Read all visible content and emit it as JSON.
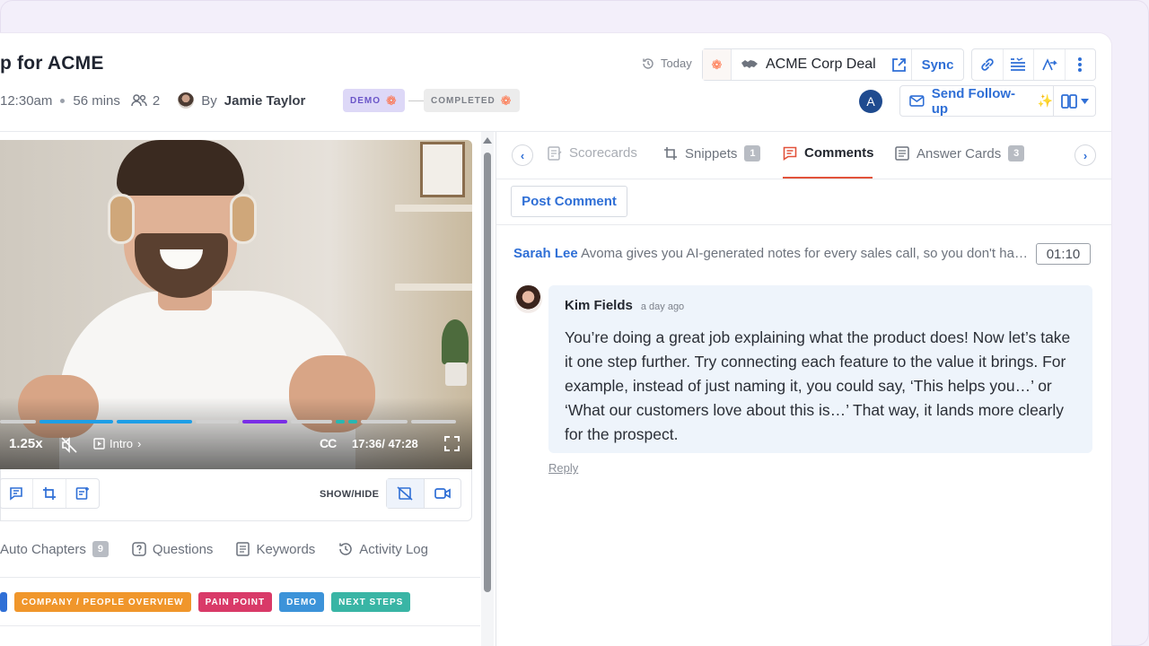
{
  "header": {
    "title": "p for ACME",
    "time": "12:30am",
    "duration": "56 mins",
    "participants": "2",
    "by_prefix": "By",
    "owner": "Jamie Taylor",
    "pills": [
      {
        "label": "DEMO"
      },
      {
        "label": "COMPLETED"
      }
    ],
    "today": "Today",
    "deal_name": "ACME Corp Deal",
    "sync": "Sync",
    "user_initial": "A",
    "follow_up": "Send Follow-up"
  },
  "video": {
    "speed": "1.25x",
    "chapter": "Intro",
    "cc": "CC",
    "time": "17:36/ 47:28",
    "progress_segments": [
      {
        "color": "#d0d0d0",
        "w": 40
      },
      {
        "color": "#1e9fe6",
        "w": 82
      },
      {
        "color": "#1e9fe6",
        "w": 84
      },
      {
        "color": "#d0d0d0",
        "w": 48
      },
      {
        "color": "#7a2ee6",
        "w": 50
      },
      {
        "color": "#d0d0d0",
        "w": 46
      },
      {
        "color": "#28b7b2",
        "w": 10
      },
      {
        "color": "#28b7b2",
        "w": 10
      },
      {
        "color": "#d0d0d0",
        "w": 52
      },
      {
        "color": "#d0d0d0",
        "w": 50
      }
    ]
  },
  "video_tools": {
    "show_hide": "SHOW/HIDE"
  },
  "left_tabs": [
    {
      "label": "Auto Chapters",
      "badge": "9"
    },
    {
      "label": "Questions"
    },
    {
      "label": "Keywords"
    },
    {
      "label": "Activity Log"
    }
  ],
  "chips": [
    {
      "label": "COMPANY / PEOPLE OVERVIEW",
      "color": "#f0962b"
    },
    {
      "label": "PAIN POINT",
      "color": "#d93a68"
    },
    {
      "label": "DEMO",
      "color": "#3c93d9"
    },
    {
      "label": "NEXT STEPS",
      "color": "#39b5a5"
    }
  ],
  "right_tabs": [
    {
      "label": "Scorecards"
    },
    {
      "label": "Snippets",
      "badge": "1"
    },
    {
      "label": "Comments"
    },
    {
      "label": "Answer Cards",
      "badge": "3"
    }
  ],
  "post_comment": "Post Comment",
  "snippet": {
    "author": "Sarah Lee",
    "text": "Avoma gives you AI-generated notes for every sales call, so you don't have...",
    "timestamp": "01:10"
  },
  "comment": {
    "name": "Kim Fields",
    "time": "a day ago",
    "text": "You’re doing a great job explaining what the product does! Now let’s take it one step further. Try connecting each feature to the value it brings. For example, instead of just naming it, you could say, ‘This helps you…’ or ‘What our customers love about this is…’ That way, it lands more clearly for the prospect.",
    "reply": "Reply"
  },
  "colors": {
    "accent": "#2f6fd6",
    "hubspot": "#ff6a3d",
    "active_tab_underline": "#e2523a",
    "comment_bg": "#eef4fb"
  }
}
